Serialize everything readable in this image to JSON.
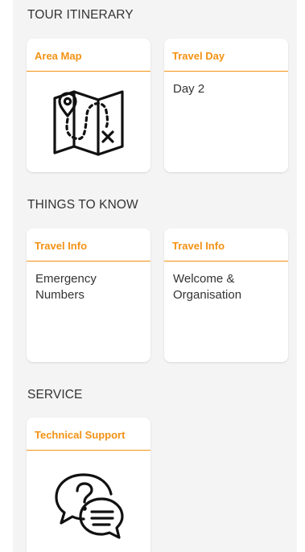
{
  "sections": [
    {
      "title": "TOUR ITINERARY",
      "cards": [
        {
          "header": "Area Map",
          "icon": "folded-map-route-icon"
        },
        {
          "header": "Travel Day",
          "body": "Day 2"
        }
      ]
    },
    {
      "title": "THINGS TO KNOW",
      "cards": [
        {
          "header": "Travel Info",
          "body_line1": "Emergency",
          "body_line2": "Numbers"
        },
        {
          "header": "Travel Info",
          "body_line1": "Welcome &",
          "body_line2": "Organisation"
        }
      ]
    },
    {
      "title": "SERVICE",
      "cards": [
        {
          "header": "Technical Support",
          "icon": "chat-question-bubbles-icon"
        }
      ]
    }
  ],
  "colors": {
    "accent": "#f39214",
    "panel_background": "#f4f4f4",
    "card_background": "#ffffff",
    "text": "#333333"
  }
}
